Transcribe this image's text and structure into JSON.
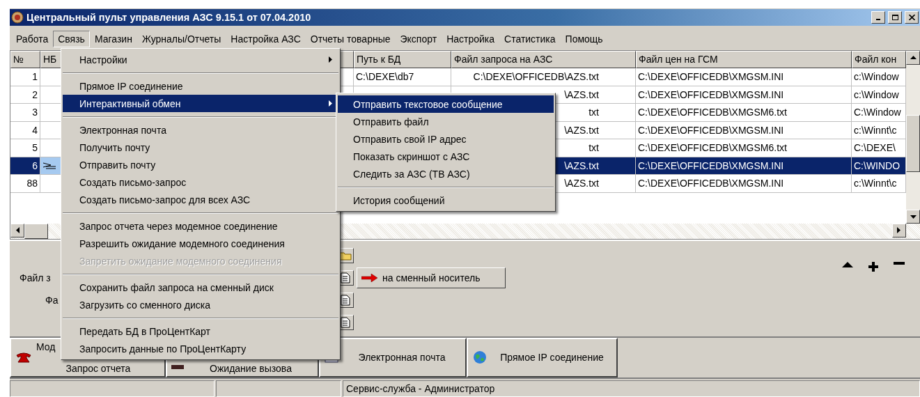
{
  "window": {
    "title": "Центральный пульт управления АЗС 9.15.1 от 07.04.2010"
  },
  "menu_bar": [
    {
      "label": "Работа",
      "selected": false
    },
    {
      "label": "Связь",
      "selected": true
    },
    {
      "label": "Магазин",
      "selected": false
    },
    {
      "label": "Журналы/Отчеты",
      "selected": false
    },
    {
      "label": "Настройка АЗС",
      "selected": false
    },
    {
      "label": "Отчеты товарные",
      "selected": false
    },
    {
      "label": "Экспорт",
      "selected": false
    },
    {
      "label": "Настройка",
      "selected": false
    },
    {
      "label": "Статистика",
      "selected": false
    },
    {
      "label": "Помощь",
      "selected": false
    }
  ],
  "open_menu": {
    "items": [
      {
        "kind": "item",
        "label": "Настройки",
        "submenu": true,
        "selected": false,
        "disabled": false
      },
      {
        "kind": "separator"
      },
      {
        "kind": "item",
        "label": "Прямое IP соединение",
        "submenu": false,
        "selected": false,
        "disabled": false
      },
      {
        "kind": "item",
        "label": "Интерактивный обмен",
        "submenu": true,
        "selected": true,
        "disabled": false
      },
      {
        "kind": "separator"
      },
      {
        "kind": "item",
        "label": "Электронная почта",
        "submenu": false,
        "selected": false,
        "disabled": false
      },
      {
        "kind": "item",
        "label": "Получить почту",
        "submenu": false,
        "selected": false,
        "disabled": false
      },
      {
        "kind": "item",
        "label": "Отправить почту",
        "submenu": false,
        "selected": false,
        "disabled": false
      },
      {
        "kind": "item",
        "label": "Создать письмо-запрос",
        "submenu": false,
        "selected": false,
        "disabled": false
      },
      {
        "kind": "item",
        "label": "Создать письмо-запрос для всех АЗС",
        "submenu": false,
        "selected": false,
        "disabled": false
      },
      {
        "kind": "separator"
      },
      {
        "kind": "item",
        "label": "Запрос отчета через модемное соединение",
        "submenu": false,
        "selected": false,
        "disabled": false
      },
      {
        "kind": "item",
        "label": "Разрешить ожидание модемного соединения",
        "submenu": false,
        "selected": false,
        "disabled": false
      },
      {
        "kind": "item",
        "label": "Запретить ожидание модемного соединения",
        "submenu": false,
        "selected": false,
        "disabled": true
      },
      {
        "kind": "separator"
      },
      {
        "kind": "item",
        "label": "Сохранить файл запроса на сменный диск",
        "submenu": false,
        "selected": false,
        "disabled": false
      },
      {
        "kind": "item",
        "label": "Загрузить со сменного диска",
        "submenu": false,
        "selected": false,
        "disabled": false
      },
      {
        "kind": "separator"
      },
      {
        "kind": "item",
        "label": "Передать БД в ПроЦентКарт",
        "submenu": false,
        "selected": false,
        "disabled": false
      },
      {
        "kind": "item",
        "label": "Запросить данные по ПроЦентКарту",
        "submenu": false,
        "selected": false,
        "disabled": false
      }
    ]
  },
  "submenu": {
    "items": [
      {
        "kind": "item",
        "label": "Отправить текстовое сообщение",
        "selected": true
      },
      {
        "kind": "item",
        "label": "Отправить файл",
        "selected": false
      },
      {
        "kind": "item",
        "label": "Отправить свой IP адрес",
        "selected": false
      },
      {
        "kind": "item",
        "label": "Показать скриншот с АЗС",
        "selected": false
      },
      {
        "kind": "item",
        "label": "Следить за АЗС (ТВ АЗС)",
        "selected": false
      },
      {
        "kind": "separator"
      },
      {
        "kind": "item",
        "label": "История сообщений",
        "selected": false
      }
    ]
  },
  "table": {
    "columns": [
      "№",
      "НБ",
      "Путь к БД",
      "Файл запроса на АЗС",
      "Файл цен на ГСМ",
      "Файл кон"
    ],
    "rows": [
      {
        "selected": false,
        "number": "1",
        "path": "C:\\DEXE\\db7",
        "request_file": "C:\\DEXE\\OFFICEDB\\AZS.txt",
        "price_file": "C:\\DEXE\\OFFICEDB\\XMGSM.INI",
        "column_6": "c:\\Window"
      },
      {
        "selected": false,
        "number": "2",
        "request_file": "\\AZS.txt",
        "price_file": "C:\\DEXE\\OFFICEDB\\XMGSM.INI",
        "column_6": "c:\\Window"
      },
      {
        "selected": false,
        "number": "3",
        "request_file": "txt",
        "price_file": "C:\\DEXE\\OFFICEDB\\XMGSM6.txt",
        "column_6": "C:\\Window"
      },
      {
        "selected": false,
        "number": "4",
        "request_file": "\\AZS.txt",
        "price_file": "C:\\DEXE\\OFFICEDB\\XMGSM.INI",
        "column_6": "c:\\Winnt\\c"
      },
      {
        "selected": false,
        "number": "5",
        "request_file": "txt",
        "price_file": "C:\\DEXE\\OFFICEDB\\XMGSM6.txt",
        "column_6": "C:\\DEXE\\"
      },
      {
        "selected": true,
        "number": "6",
        "request_file": "\\AZS.txt",
        "price_file": "C:\\DEXE\\OFFICEDB\\XMGSM.INI",
        "column_6": "C:\\WINDO"
      },
      {
        "selected": false,
        "number": "88",
        "request_file": "\\AZS.txt",
        "price_file": "C:\\DEXE\\OFFICEDB\\XMGSM.INI",
        "column_6": "c:\\Winnt\\c"
      }
    ]
  },
  "panel": {
    "labels": [
      "Файл з",
      "Фа"
    ],
    "media_button": "на сменный носитель"
  },
  "bottom_buttons": [
    {
      "kind": "phone",
      "lines": [
        "Мод",
        "Запрос отчета"
      ]
    },
    {
      "kind": "wait",
      "lines": [
        "Ожидание вызова"
      ]
    },
    {
      "kind": "mail",
      "lines": [
        "Электронная почта"
      ]
    },
    {
      "kind": "globe",
      "lines": [
        "Прямое IP соединение"
      ]
    }
  ],
  "status_bar": {
    "text": "Сервис-служба - Администратор"
  }
}
